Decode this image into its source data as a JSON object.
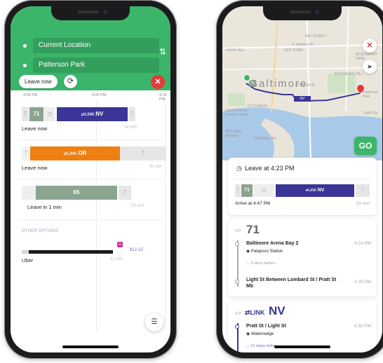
{
  "left_phone": {
    "origin": "Current Location",
    "destination": "Patterson Park",
    "leave_now_pill": "Leave now",
    "time_ticks": [
      "3:45 PM",
      "4:00 PM",
      "4:15 PM"
    ],
    "routes": [
      {
        "bus": "71",
        "line": "NV",
        "label": "Leave now",
        "duration": "24 min"
      },
      {
        "line": "OR",
        "label": "Leave now",
        "duration": "31 min"
      },
      {
        "bus": "65",
        "label": "Leave in 1 min",
        "duration": "25 min"
      }
    ],
    "other_options_heading": "OTHER OPTIONS",
    "uber": {
      "label": "Uber",
      "price": "$12-15",
      "duration": "21 min"
    },
    "colors": {
      "green": "#3bb56a",
      "nv": "#3a3596",
      "or": "#f07f11",
      "close": "#e53a3a"
    },
    "icons": [
      "swap-icon",
      "refresh-icon",
      "close-icon",
      "walk-icon",
      "clock-icon",
      "link-logo-icon",
      "filter-icon"
    ]
  },
  "right_phone": {
    "map_city": "Baltimore",
    "map_labels": {
      "bay_street": "BAY STREET",
      "old_town": "OLD TOWN",
      "e_madison": "E Madison St",
      "mcelderry": "MCELDERRY PARK",
      "butchers_hill": "BUTCHER'S HILL",
      "patterson_park": "Patterson Park",
      "canton": "CANTON",
      "otterbein": "OTTERBEIN",
      "federal_hill": "FEDERAL HILL",
      "camden_yards": "Oriole Park at Camden Yards",
      "ravens_stadium": "M&T Bank Stadium",
      "union_hill": "UNION HILL",
      "fells_point": "E Fayette St"
    },
    "go_label": "GO",
    "summary": {
      "leave_at": "Leave at 4:23 PM",
      "bus": "71",
      "line": "NV",
      "arrive": "Arrive at 4:47 PM",
      "duration": "24 min"
    },
    "bus_leg": {
      "number": "71",
      "board_stop": "Baltimore Arena Bay 2",
      "board_time": "4:24 PM",
      "board_sub": "Patapsco Station",
      "stops_before": "3 stops before...",
      "alight_stop": "Light St Between Lombard St / Pratt St Mb",
      "alight_time": "4:26 PM"
    },
    "link_leg": {
      "line": "NV",
      "board_stop": "Pratt St / Light St",
      "board_time": "4:30 PM",
      "board_sub": "Watersedge",
      "stops_before": "10 stops before..."
    },
    "icons": [
      "close-icon",
      "locate-arrow-icon",
      "clock-icon",
      "bus-icon",
      "walk-icon",
      "pin-icon"
    ]
  }
}
